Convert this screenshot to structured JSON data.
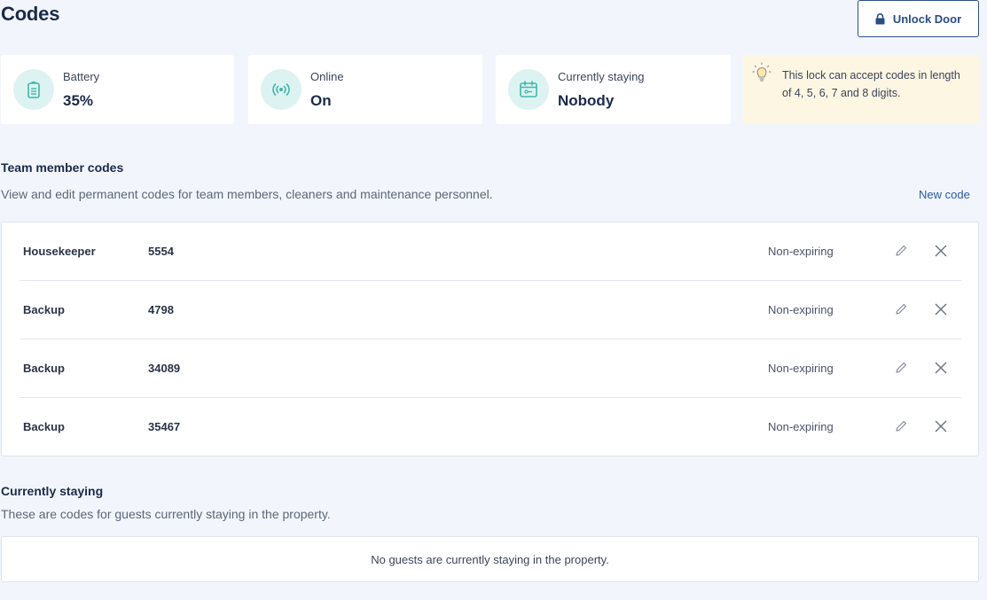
{
  "header": {
    "title": "Codes",
    "unlock_label": "Unlock Door"
  },
  "stats": [
    {
      "label": "Battery",
      "value": "35%",
      "icon": "battery-icon"
    },
    {
      "label": "Online",
      "value": "On",
      "icon": "signal-icon"
    },
    {
      "label": "Currently staying",
      "value": "Nobody",
      "icon": "calendar-icon"
    }
  ],
  "tip": {
    "icon": "lightbulb-icon",
    "text": "This lock can accept codes in length of 4, 5, 6, 7 and 8 digits."
  },
  "team_codes": {
    "title": "Team member codes",
    "description": "View and edit permanent codes for team members, cleaners and maintenance personnel.",
    "new_code_label": "New code",
    "rows": [
      {
        "name": "Housekeeper",
        "code": "5554",
        "expiry": "Non-expiring"
      },
      {
        "name": "Backup",
        "code": "4798",
        "expiry": "Non-expiring"
      },
      {
        "name": "Backup",
        "code": "34089",
        "expiry": "Non-expiring"
      },
      {
        "name": "Backup",
        "code": "35467",
        "expiry": "Non-expiring"
      }
    ]
  },
  "currently_staying": {
    "title": "Currently staying",
    "description": "These are codes for guests currently staying in the property.",
    "empty_message": "No guests are currently staying in the property."
  },
  "colors": {
    "background": "#f2f6fc",
    "accent": "#2a4d84",
    "icon_bg": "#ddf3f1",
    "icon_fg": "#3fb8ad",
    "tip_bg": "#fdf6e3"
  }
}
